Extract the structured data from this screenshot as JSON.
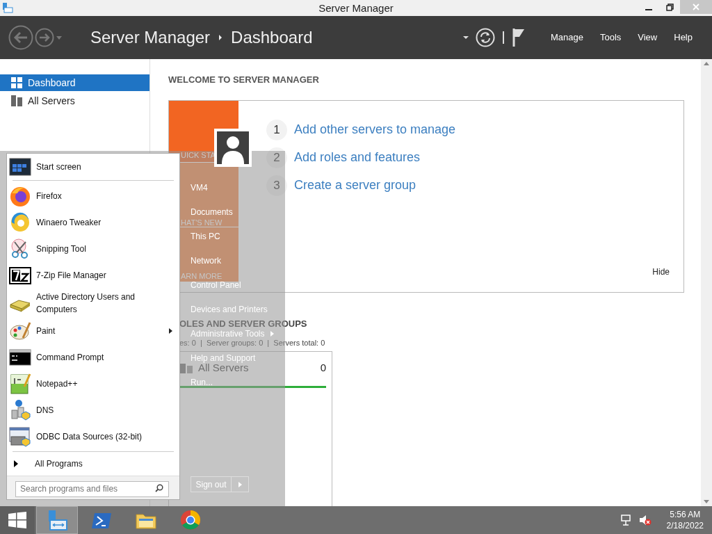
{
  "window": {
    "title": "Server Manager"
  },
  "header": {
    "breadcrumb": [
      "Server Manager",
      "Dashboard"
    ],
    "menus": [
      "Manage",
      "Tools",
      "View",
      "Help"
    ]
  },
  "sidebar": {
    "items": [
      {
        "label": "Dashboard",
        "kind": "dashboard",
        "selected": true
      },
      {
        "label": "All Servers",
        "kind": "servers",
        "selected": false
      }
    ]
  },
  "welcome": {
    "heading": "WELCOME TO SERVER MANAGER",
    "tiles": [
      "UICK STA",
      "HAT'S NEW",
      "ARN MORE"
    ],
    "steps": [
      {
        "number": "1",
        "label": "Add other servers to manage"
      },
      {
        "number": "2",
        "label": "Add roles and features"
      },
      {
        "number": "3",
        "label": "Create a server group"
      }
    ],
    "hide": "Hide"
  },
  "roles": {
    "heading": "OLES AND SERVER GROUPS",
    "summary": "es: 0  |  Server groups: 0  |  Servers total: 0",
    "tiles": [
      {
        "title": "All Servers",
        "count": "0"
      }
    ]
  },
  "start_menu": {
    "programs": [
      {
        "label": "Start screen",
        "kind": "start-screen",
        "submenu": false
      },
      {
        "label": "Firefox",
        "kind": "firefox",
        "submenu": false
      },
      {
        "label": "Winaero Tweaker",
        "kind": "winaero",
        "submenu": false
      },
      {
        "label": "Snipping Tool",
        "kind": "snipping",
        "submenu": false
      },
      {
        "label": "7-Zip File Manager",
        "kind": "archiver",
        "submenu": false
      },
      {
        "label": "Active Directory Users and Computers",
        "kind": "directory",
        "submenu": false
      },
      {
        "label": "Paint",
        "kind": "paint",
        "submenu": true
      },
      {
        "label": "Command Prompt",
        "kind": "cmd",
        "submenu": false
      },
      {
        "label": "Notepad++",
        "kind": "notepad",
        "submenu": false
      },
      {
        "label": "DNS",
        "kind": "dns",
        "submenu": false
      },
      {
        "label": "ODBC Data Sources (32-bit)",
        "kind": "odbc",
        "submenu": false
      }
    ],
    "all_programs": "All Programs",
    "search": {
      "placeholder": "Search programs and files"
    },
    "places": [
      {
        "label": "VM4",
        "submenu": false
      },
      {
        "label": "Documents",
        "submenu": false
      },
      {
        "label": "This PC",
        "submenu": false
      },
      {
        "label": "Network",
        "submenu": false
      },
      {
        "label": "Control Panel",
        "submenu": false
      },
      {
        "label": "Devices and Printers",
        "submenu": false
      },
      {
        "label": "Administrative Tools",
        "submenu": true
      },
      {
        "label": "Help and Support",
        "submenu": false
      },
      {
        "label": "Run...",
        "submenu": false
      }
    ],
    "sign_out": "Sign out"
  },
  "taskbar": {
    "apps": [
      {
        "kind": "server-manager",
        "active": true
      },
      {
        "kind": "powershell",
        "active": false
      },
      {
        "kind": "file-explorer",
        "active": false
      },
      {
        "kind": "chrome",
        "active": false
      }
    ],
    "volume_muted": true,
    "time": "5:56 AM",
    "date": "2/18/2022"
  }
}
